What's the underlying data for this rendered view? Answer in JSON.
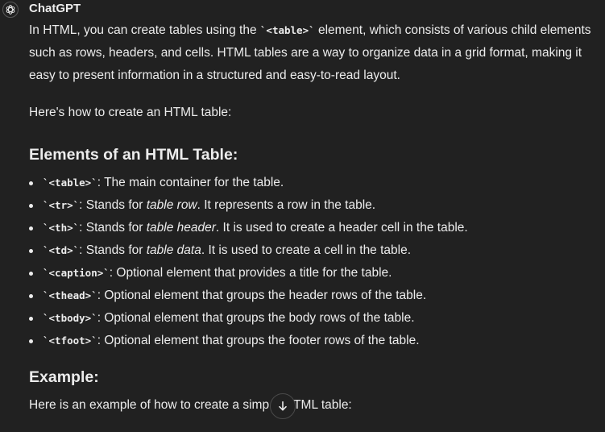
{
  "message": {
    "sender": "ChatGPT",
    "intro": {
      "a": "In HTML, you can create tables using the ",
      "code": "`<table>`",
      "b": " element, which consists of various child elements such as rows, headers, and cells. HTML tables are a way to organize data in a grid format, making it easy to present information in a structured and easy-to-read layout."
    },
    "howto": "Here's how to create an HTML table:",
    "elements_heading": "Elements of an HTML Table:",
    "elements": [
      {
        "code": "`<table>`",
        "pre": ": The main container for the table.",
        "em": "",
        "post": ""
      },
      {
        "code": "`<tr>`",
        "pre": ": Stands for ",
        "em": "table row",
        "post": ". It represents a row in the table."
      },
      {
        "code": "`<th>`",
        "pre": ": Stands for ",
        "em": "table header",
        "post": ". It is used to create a header cell in the table."
      },
      {
        "code": "`<td>`",
        "pre": ": Stands for ",
        "em": "table data",
        "post": ". It is used to create a cell in the table."
      },
      {
        "code": "`<caption>`",
        "pre": ": Optional element that provides a title for the table.",
        "em": "",
        "post": ""
      },
      {
        "code": "`<thead>`",
        "pre": ": Optional element that groups the header rows of the table.",
        "em": "",
        "post": ""
      },
      {
        "code": "`<tbody>`",
        "pre": ": Optional element that groups the body rows of the table.",
        "em": "",
        "post": ""
      },
      {
        "code": "`<tfoot>`",
        "pre": ": Optional element that groups the footer rows of the table.",
        "em": "",
        "post": ""
      }
    ],
    "example_heading": "Example:",
    "example_text": {
      "a": "Here is an example of how to create a simp",
      "b": "TML table:"
    }
  },
  "icons": {
    "avatar": "openai-logo-icon",
    "scroll": "arrow-down-icon"
  },
  "colors": {
    "background": "#212121",
    "text": "#ececec"
  }
}
